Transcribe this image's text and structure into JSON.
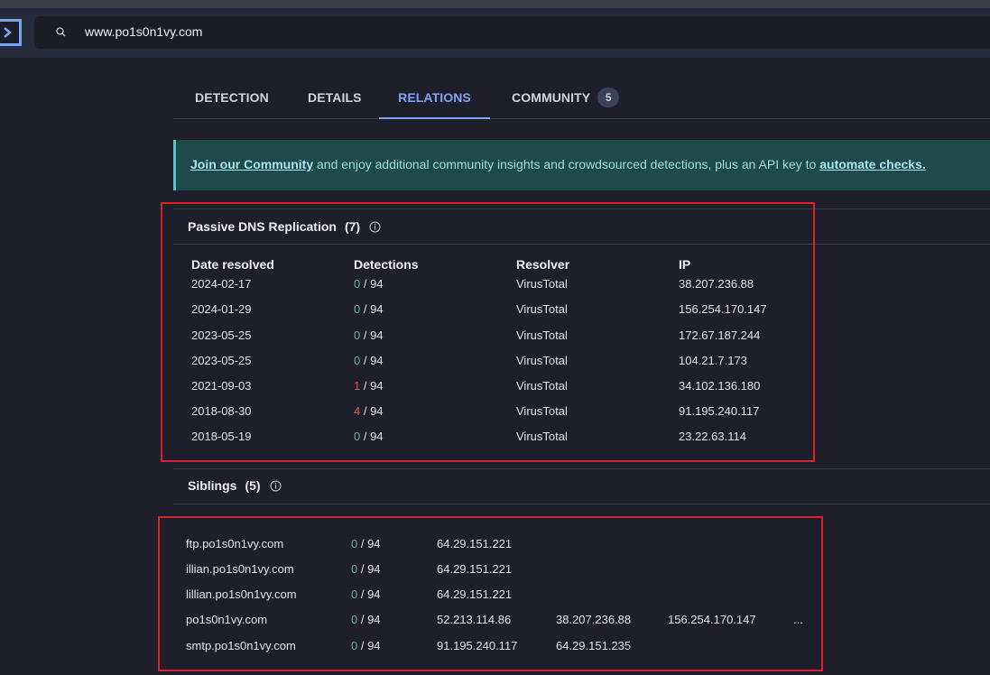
{
  "search": {
    "value": "www.po1s0n1vy.com"
  },
  "tabs": [
    {
      "label": "DETECTION"
    },
    {
      "label": "DETAILS"
    },
    {
      "label": "RELATIONS"
    },
    {
      "label": "COMMUNITY",
      "badge": "5"
    }
  ],
  "banner": {
    "link1": "Join our Community",
    "text": " and enjoy additional community insights and crowdsourced detections, plus an API key to ",
    "link2": "automate checks."
  },
  "passive_dns": {
    "title": "Passive DNS Replication",
    "count": "(7)",
    "headers": [
      "Date resolved",
      "Detections",
      "Resolver",
      "IP"
    ],
    "rows": [
      {
        "date": "2024-02-17",
        "det": "0",
        "total": " / 94",
        "resolver": "VirusTotal",
        "ip": "38.207.236.88"
      },
      {
        "date": "2024-01-29",
        "det": "0",
        "total": " / 94",
        "resolver": "VirusTotal",
        "ip": "156.254.170.147"
      },
      {
        "date": "2023-05-25",
        "det": "0",
        "total": " / 94",
        "resolver": "VirusTotal",
        "ip": "172.67.187.244"
      },
      {
        "date": "2023-05-25",
        "det": "0",
        "total": " / 94",
        "resolver": "VirusTotal",
        "ip": "104.21.7.173"
      },
      {
        "date": "2021-09-03",
        "det": "1",
        "total": " / 94",
        "resolver": "VirusTotal",
        "ip": "34.102.136.180"
      },
      {
        "date": "2018-08-30",
        "det": "4",
        "total": " / 94",
        "resolver": "VirusTotal",
        "ip": "91.195.240.117"
      },
      {
        "date": "2018-05-19",
        "det": "0",
        "total": " / 94",
        "resolver": "VirusTotal",
        "ip": "23.22.63.114"
      }
    ]
  },
  "siblings": {
    "title": "Siblings",
    "count": "(5)",
    "rows": [
      {
        "domain": "ftp.po1s0n1vy.com",
        "det": "0",
        "total": " / 94",
        "ip1": "64.29.151.221",
        "ip2": "",
        "ip3": "",
        "more": ""
      },
      {
        "domain": "illian.po1s0n1vy.com",
        "det": "0",
        "total": " / 94",
        "ip1": "64.29.151.221",
        "ip2": "",
        "ip3": "",
        "more": ""
      },
      {
        "domain": "lillian.po1s0n1vy.com",
        "det": "0",
        "total": " / 94",
        "ip1": "64.29.151.221",
        "ip2": "",
        "ip3": "",
        "more": ""
      },
      {
        "domain": "po1s0n1vy.com",
        "det": "0",
        "total": " / 94",
        "ip1": "52.213.114.86",
        "ip2": "38.207.236.88",
        "ip3": "156.254.170.147",
        "more": "..."
      },
      {
        "domain": "smtp.po1s0n1vy.com",
        "det": "0",
        "total": " / 94",
        "ip1": "91.195.240.117",
        "ip2": "64.29.151.235",
        "ip3": "",
        "more": ""
      }
    ]
  },
  "colors": {
    "accent": "#7fa3ee",
    "clean": "#58b89a",
    "malicious": "#ef5350",
    "highlight": "#d9232b"
  }
}
